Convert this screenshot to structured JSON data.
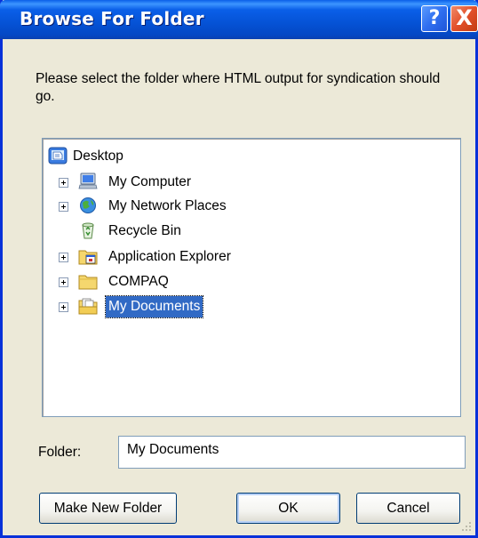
{
  "window": {
    "title": "Browse For Folder",
    "help_glyph": "?",
    "close_glyph": "X"
  },
  "prompt": "Please select the folder where HTML output for syndication should go.",
  "tree": {
    "items": [
      {
        "label": "Desktop",
        "icon": "desktop-icon",
        "expandable": false,
        "level": 0
      },
      {
        "label": "My Computer",
        "icon": "my-computer-icon",
        "expandable": true,
        "level": 1
      },
      {
        "label": "My Network Places",
        "icon": "network-places-icon",
        "expandable": true,
        "level": 1
      },
      {
        "label": "Recycle Bin",
        "icon": "recycle-bin-icon",
        "expandable": false,
        "level": 1
      },
      {
        "label": "Application Explorer",
        "icon": "application-folder-icon",
        "expandable": true,
        "level": 1
      },
      {
        "label": "COMPAQ",
        "icon": "folder-icon",
        "expandable": true,
        "level": 1
      },
      {
        "label": "My Documents",
        "icon": "my-documents-icon",
        "expandable": true,
        "level": 1,
        "selected": true
      }
    ]
  },
  "folder": {
    "label": "Folder:",
    "value": "My Documents"
  },
  "buttons": {
    "make_new_folder": "Make New Folder",
    "ok": "OK",
    "cancel": "Cancel"
  },
  "colors": {
    "titlebar": "#0552d5",
    "selection": "#316ac5",
    "close_button": "#e2502a",
    "dialog_background": "#ece9d8"
  }
}
